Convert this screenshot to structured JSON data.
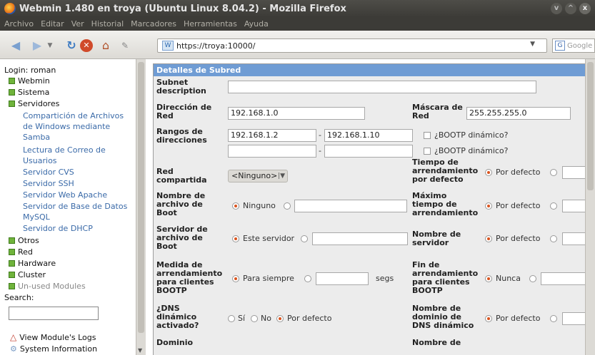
{
  "window": {
    "title": "Webmin 1.480 en troya (Ubuntu Linux 8.04.2) - Mozilla Firefox",
    "controls": [
      "v",
      "^",
      "x"
    ]
  },
  "menubar": [
    "Archivo",
    "Editar",
    "Ver",
    "Historial",
    "Marcadores",
    "Herramientas",
    "Ayuda"
  ],
  "toolbar": {
    "url": "https://troya:10000/",
    "search_placeholder": "Google"
  },
  "sidebar": {
    "login": "Login: roman",
    "categories": {
      "webmin": "Webmin",
      "sistema": "Sistema",
      "servidores": "Servidores",
      "otros": "Otros",
      "red": "Red",
      "hardware": "Hardware",
      "cluster": "Cluster",
      "unused": "Un-used Modules"
    },
    "servers": [
      "Compartición de Archivos",
      "de Windows mediante",
      "Samba",
      "Lectura de Correo de",
      "Usuarios",
      "Servidor CVS",
      "Servidor SSH",
      "Servidor Web Apache",
      "Servidor de Base de Datos",
      "MySQL",
      "Servidor de DHCP"
    ],
    "search_label": "Search:",
    "view_logs": "View Module's Logs",
    "system_info": "System Information"
  },
  "panel": {
    "title": "Detalles de Subred",
    "subnet_description": {
      "label1": "Subnet",
      "label2": "description",
      "value": ""
    },
    "network_address": {
      "label1": "Dirección de",
      "label2": "Red",
      "value": "192.168.1.0"
    },
    "netmask": {
      "label1": "Máscara de",
      "label2": "Red",
      "value": "255.255.255.0"
    },
    "address_ranges": {
      "label1": "Rangos de",
      "label2": "direcciones",
      "start1": "192.168.1.2",
      "end1": "192.168.1.10",
      "start2": "",
      "end2": "",
      "bootp": "¿BOOTP dinámico?",
      "dash": "-"
    },
    "shared_network": {
      "label1": "Red",
      "label2": "compartida",
      "value": "<Ninguno>"
    },
    "lease_time": {
      "label1": "Tiempo de",
      "label2": "arrendamiento",
      "label3": "por defecto",
      "option": "Por defecto"
    },
    "boot_filename": {
      "label1": "Nombre de",
      "label2": "archivo de",
      "label3": "Boot",
      "option": "Ninguno"
    },
    "max_lease": {
      "label1": "Máximo",
      "label2": "tiempo de",
      "label3": "arrendamiento",
      "option": "Por defecto"
    },
    "boot_server": {
      "label1": "Servidor de",
      "label2": "archivo de",
      "label3": "Boot",
      "option": "Este servidor"
    },
    "server_name": {
      "label1": "Nombre de",
      "label2": "servidor",
      "option": "Por defecto"
    },
    "bootp_lease": {
      "label1": "Medida de",
      "label2": "arrendamiento",
      "label3": "para clientes",
      "label4": "BOOTP",
      "option": "Para siempre",
      "unit": "segs"
    },
    "bootp_end": {
      "label1": "Fin de",
      "label2": "arrendamiento",
      "label3": "para clientes",
      "label4": "BOOTP",
      "option": "Nunca"
    },
    "ddns": {
      "label1": "¿DNS",
      "label2": "dinámico",
      "label3": "activado?",
      "yes": "Sí",
      "no": "No",
      "default": "Por defecto"
    },
    "ddns_domain": {
      "label1": "Nombre de",
      "label2": "dominio de",
      "label3": "DNS dinámico",
      "option": "Por defecto"
    },
    "cut_left": "Dominio",
    "cut_right": "Nombre de"
  }
}
